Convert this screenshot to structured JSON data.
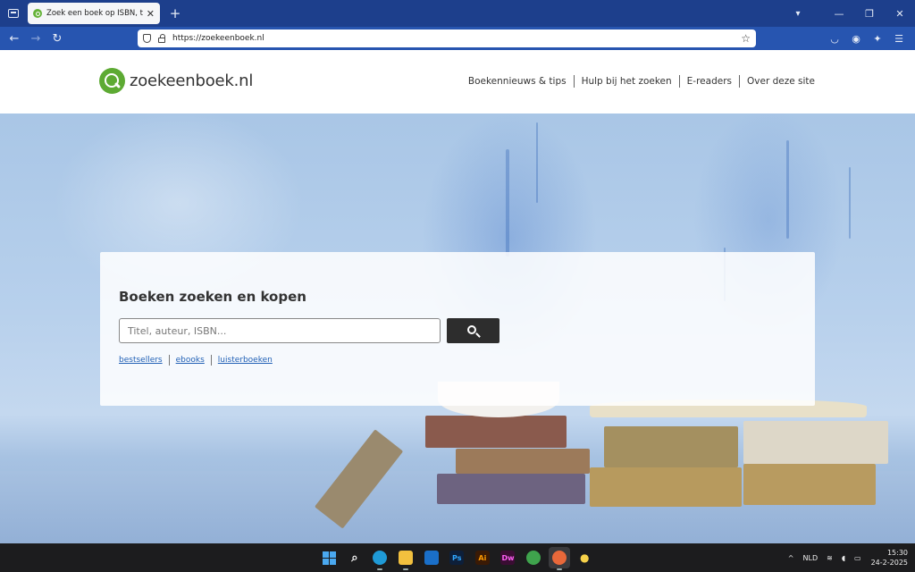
{
  "browser": {
    "tab_title": "Zoek een boek op ISBN, titel, auteur",
    "url": "https://zoekeenboek.nl"
  },
  "site": {
    "logo_text": "zoekeenboek.nl",
    "nav": [
      "Boekennieuws & tips",
      "Hulp bij het zoeken",
      "E-readers",
      "Over deze site"
    ]
  },
  "search": {
    "title": "Boeken zoeken en kopen",
    "placeholder": "Titel, auteur, ISBN...",
    "links": [
      "bestsellers",
      "ebooks",
      "luisterboeken"
    ]
  },
  "taskbar": {
    "apps": [
      {
        "name": "start",
        "label": "",
        "color": "#4aa8f0"
      },
      {
        "name": "search",
        "label": "",
        "color": "#1c1c1e"
      },
      {
        "name": "edge",
        "label": "",
        "color": "#1f9ad6"
      },
      {
        "name": "file-explorer",
        "label": "",
        "color": "#f2c03e"
      },
      {
        "name": "outlook",
        "label": "",
        "color": "#1a6fc9"
      },
      {
        "name": "photoshop",
        "label": "Ps",
        "color": "#0d1f3a"
      },
      {
        "name": "illustrator",
        "label": "Ai",
        "color": "#3a1a05"
      },
      {
        "name": "dreamweaver",
        "label": "Dw",
        "color": "#3a0d33"
      },
      {
        "name": "chrome",
        "label": "",
        "color": "#3fa34d"
      },
      {
        "name": "firefox",
        "label": "",
        "color": "#e8683a"
      },
      {
        "name": "tips",
        "label": "",
        "color": "#1c1c1e"
      }
    ],
    "language": "NLD",
    "time": "15:30",
    "date": "24-2-2025"
  }
}
